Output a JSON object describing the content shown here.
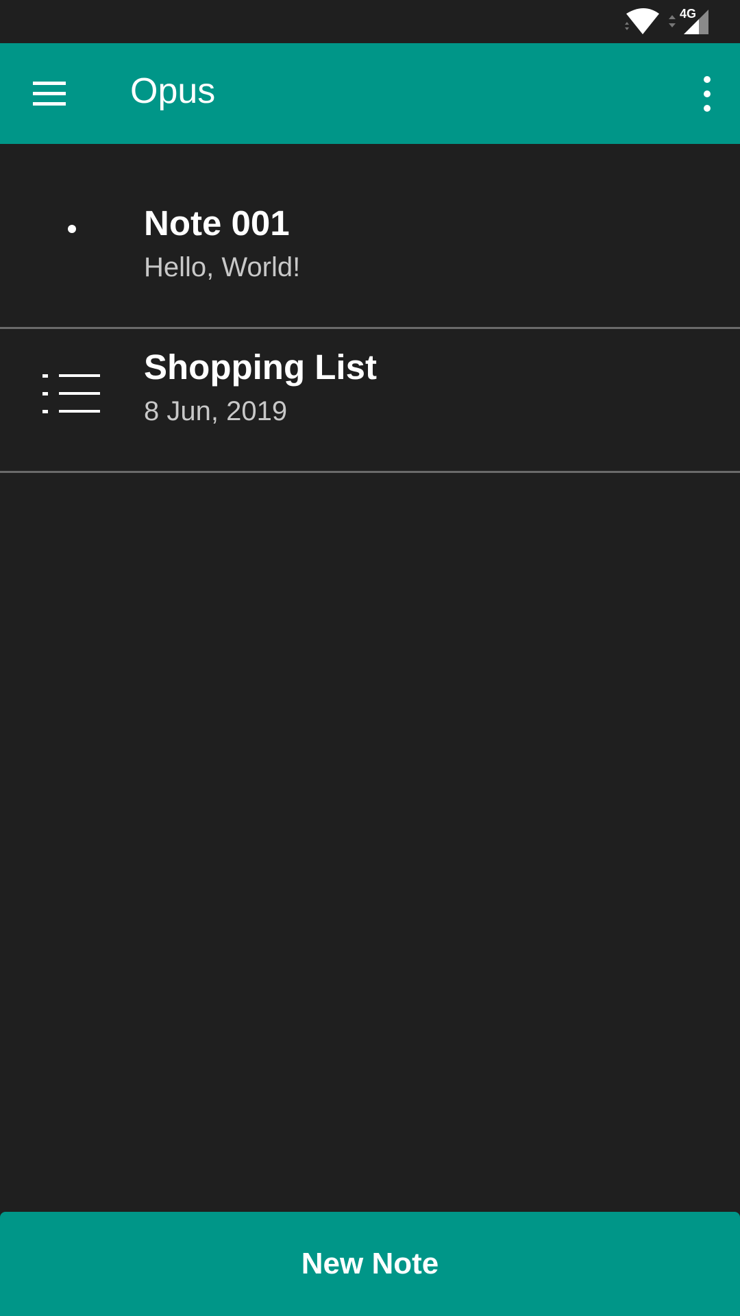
{
  "status_bar": {
    "network": "4G",
    "icons": [
      "wifi-icon",
      "data-activity-icon",
      "cellular-signal-icon"
    ]
  },
  "app_bar": {
    "title": "Opus",
    "menu_icon": "hamburger-menu-icon",
    "overflow_icon": "more-vert-icon",
    "color": "#009688"
  },
  "notes": [
    {
      "title": "Note 001",
      "subtitle": "Hello, World!",
      "icon": "text-note-icon"
    },
    {
      "title": "Shopping List",
      "subtitle": "8 Jun, 2019",
      "icon": "checklist-icon"
    }
  ],
  "new_note_button": {
    "label": "New Note",
    "color": "#009688"
  }
}
